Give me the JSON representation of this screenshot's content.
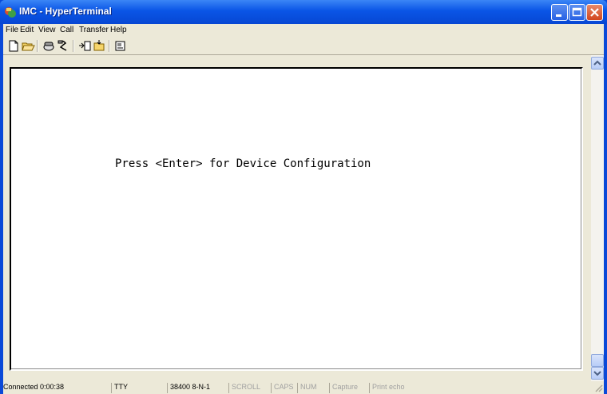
{
  "window": {
    "title": "IMC - HyperTerminal"
  },
  "menu": [
    "File",
    "Edit",
    "View",
    "Call",
    "Transfer",
    "Help"
  ],
  "toolbar": {
    "icons": [
      "new-connection-icon",
      "open-icon",
      "connect-icon",
      "disconnect-icon",
      "send-icon",
      "receive-icon",
      "properties-icon"
    ]
  },
  "terminal": {
    "text": "Press <Enter> for Device Configuration"
  },
  "status": {
    "connected": "Connected 0:00:38",
    "emulation": "TTY",
    "port_settings": "38400 8-N-1",
    "scroll": "SCROLL",
    "caps": "CAPS",
    "num": "NUM",
    "capture": "Capture",
    "print_echo": "Print echo"
  }
}
